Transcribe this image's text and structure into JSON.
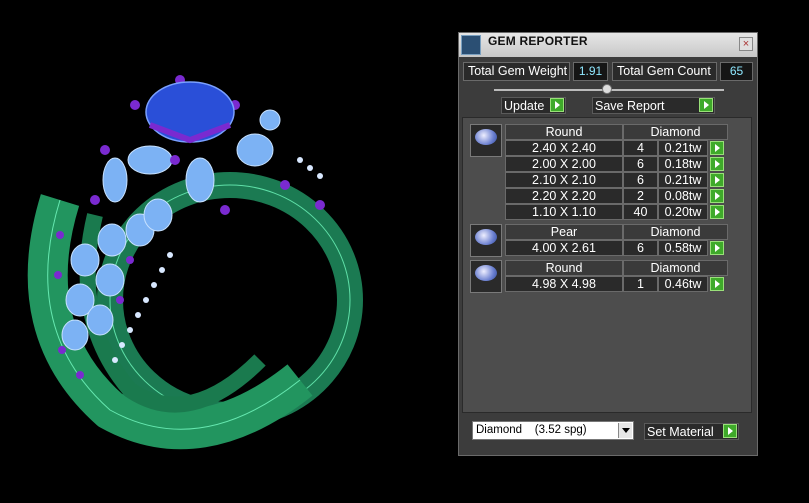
{
  "panel": {
    "title": "GEM REPORTER",
    "close": "×",
    "total_weight_label": "Total Gem Weight",
    "total_weight_value": "1.91",
    "total_count_label": "Total Gem Count",
    "total_count_value": "65",
    "update_label": "Update",
    "save_label": "Save Report",
    "material_value": "Diamond    (3.52 spg)",
    "set_material_label": "Set Material"
  },
  "groups": [
    {
      "shape": "Round",
      "material": "Diamond",
      "rows": [
        {
          "size": "2.40 X 2.40",
          "count": "4",
          "weight": "0.21tw"
        },
        {
          "size": "2.00 X 2.00",
          "count": "6",
          "weight": "0.18tw"
        },
        {
          "size": "2.10 X 2.10",
          "count": "6",
          "weight": "0.21tw"
        },
        {
          "size": "2.20 X 2.20",
          "count": "2",
          "weight": "0.08tw"
        },
        {
          "size": "1.10 X 1.10",
          "count": "40",
          "weight": "0.20tw"
        }
      ]
    },
    {
      "shape": "Pear",
      "material": "Diamond",
      "rows": [
        {
          "size": "4.00 X 2.61",
          "count": "6",
          "weight": "0.58tw"
        }
      ]
    },
    {
      "shape": "Round",
      "material": "Diamond",
      "rows": [
        {
          "size": "4.98 X 4.98",
          "count": "1",
          "weight": "0.46tw"
        }
      ]
    }
  ],
  "colors": {
    "ring": "#1f8a5a",
    "prongs": "#7a2ad0",
    "side_gems": "#6fa6f0",
    "center_gem": "#2a4fd8"
  }
}
